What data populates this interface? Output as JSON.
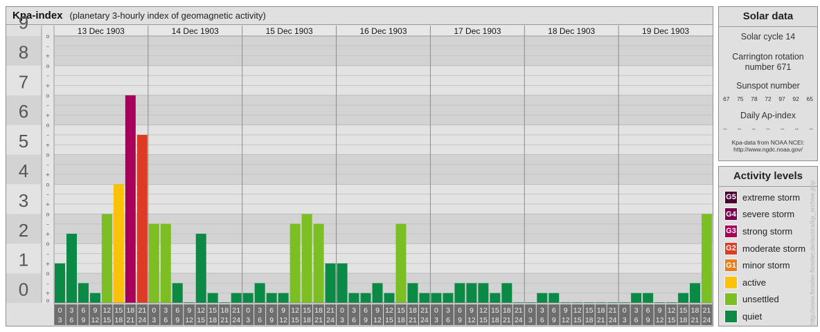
{
  "chart_data": {
    "type": "bar",
    "title": "Kpa-index",
    "subtitle": "(planetary 3-hourly index of geomagnetic activity)",
    "ylim": [
      0,
      9
    ],
    "y_ticks": [
      "0",
      "1",
      "2",
      "3",
      "4",
      "5",
      "6",
      "7",
      "8",
      "9"
    ],
    "minor_ticks": [
      "o",
      "+",
      "–"
    ],
    "days": [
      "13 Dec 1903",
      "14 Dec 1903",
      "15 Dec 1903",
      "16 Dec 1903",
      "17 Dec 1903",
      "18 Dec 1903",
      "19 Dec 1903"
    ],
    "intervals": [
      [
        "0",
        "3"
      ],
      [
        "3",
        "6"
      ],
      [
        "6",
        "9"
      ],
      [
        "9",
        "12"
      ],
      [
        "12",
        "15"
      ],
      [
        "15",
        "18"
      ],
      [
        "18",
        "21"
      ],
      [
        "21",
        "24"
      ]
    ],
    "values": [
      1.333,
      2.333,
      0.667,
      0.333,
      3.0,
      4.0,
      7.0,
      5.667,
      2.667,
      2.667,
      0.667,
      0.0,
      2.333,
      0.333,
      0.0,
      0.333,
      0.333,
      0.667,
      0.333,
      0.333,
      2.667,
      3.0,
      2.667,
      1.333,
      1.333,
      0.333,
      0.333,
      0.667,
      0.333,
      2.667,
      0.667,
      0.333,
      0.333,
      0.333,
      0.667,
      0.667,
      0.667,
      0.333,
      0.667,
      0.0,
      0.0,
      0.333,
      0.333,
      0.0,
      0.0,
      0.0,
      0.0,
      0.0,
      0.0,
      0.333,
      0.333,
      0.0,
      0.0,
      0.333,
      0.667,
      3.0
    ],
    "colors": {
      "quiet": "#0a8a45",
      "unsettled": "#7bbf22",
      "active": "#fcc20a",
      "minor": "#e67e22",
      "moderate": "#de3b24",
      "strong": "#a8005a",
      "severe": "#780050",
      "extreme": "#4a0030"
    }
  },
  "solar_data": {
    "title": "Solar data",
    "cycle_text": "Solar cycle 14",
    "carrington_text": "Carrington rotation number 671",
    "sunspot_title": "Sunspot number",
    "sunspot_values": [
      "67",
      "75",
      "78",
      "72",
      "97",
      "92",
      "65"
    ],
    "ap_title": "Daily Ap-index",
    "ap_values": [
      "--",
      "--",
      "--",
      "--",
      "--",
      "--",
      "--"
    ],
    "source_line1": "Kpa-data from NOAA NCEI:",
    "source_line2": "http://www.ngdc.noaa.gov/"
  },
  "activity_levels": {
    "title": "Activity levels",
    "items": [
      {
        "code": "G5",
        "label": "extreme storm",
        "color": "#4a0030"
      },
      {
        "code": "G4",
        "label": "severe storm",
        "color": "#780050"
      },
      {
        "code": "G3",
        "label": "strong storm",
        "color": "#a8005a"
      },
      {
        "code": "G2",
        "label": "moderate storm",
        "color": "#de3b24"
      },
      {
        "code": "G1",
        "label": "minor storm",
        "color": "#e67e22"
      },
      {
        "code": "",
        "label": "active",
        "color": "#fcc20a"
      },
      {
        "code": "",
        "label": "unsettled",
        "color": "#7bbf22"
      },
      {
        "code": "",
        "label": "quiet",
        "color": "#0a8a45"
      }
    ]
  },
  "watermark": "http://www.fieseler-fieseler.de/aurora/kp_archive.php"
}
